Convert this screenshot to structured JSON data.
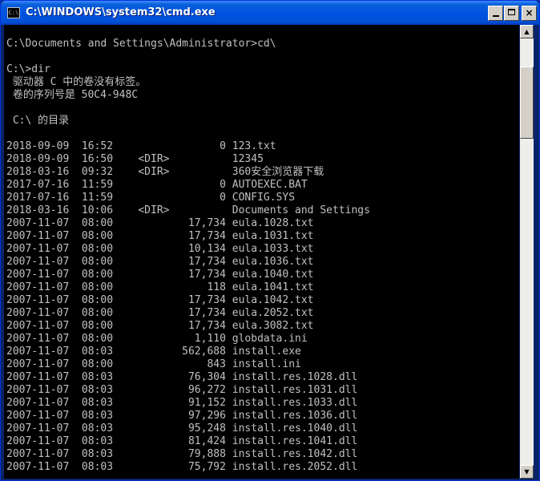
{
  "window": {
    "title": "C:\\WINDOWS\\system32\\cmd.exe",
    "icon_text": "C:\\",
    "minimize_label": "",
    "maximize_label": "",
    "close_label": "×"
  },
  "scrollbar": {
    "up_arrow": "▲",
    "down_arrow": "▼"
  },
  "console": {
    "lines": [
      "",
      "C:\\Documents and Settings\\Administrator>cd\\",
      "",
      "C:\\>dir",
      " 驱动器 C 中的卷没有标签。",
      " 卷的序列号是 50C4-948C",
      "",
      " C:\\ 的目录",
      "",
      "2018-09-09  16:52                 0 123.txt",
      "2018-09-09  16:50    <DIR>          12345",
      "2018-03-16  09:32    <DIR>          360安全浏览器下载",
      "2017-07-16  11:59                 0 AUTOEXEC.BAT",
      "2017-07-16  11:59                 0 CONFIG.SYS",
      "2018-03-16  10:06    <DIR>          Documents and Settings",
      "2007-11-07  08:00            17,734 eula.1028.txt",
      "2007-11-07  08:00            17,734 eula.1031.txt",
      "2007-11-07  08:00            10,134 eula.1033.txt",
      "2007-11-07  08:00            17,734 eula.1036.txt",
      "2007-11-07  08:00            17,734 eula.1040.txt",
      "2007-11-07  08:00               118 eula.1041.txt",
      "2007-11-07  08:00            17,734 eula.1042.txt",
      "2007-11-07  08:00            17,734 eula.2052.txt",
      "2007-11-07  08:00            17,734 eula.3082.txt",
      "2007-11-07  08:00             1,110 globdata.ini",
      "2007-11-07  08:03           562,688 install.exe",
      "2007-11-07  08:00               843 install.ini",
      "2007-11-07  08:03            76,304 install.res.1028.dll",
      "2007-11-07  08:03            96,272 install.res.1031.dll",
      "2007-11-07  08:03            91,152 install.res.1033.dll",
      "2007-11-07  08:03            97,296 install.res.1036.dll",
      "2007-11-07  08:03            95,248 install.res.1040.dll",
      "2007-11-07  08:03            81,424 install.res.1041.dll",
      "2007-11-07  08:03            79,888 install.res.1042.dll",
      "2007-11-07  08:03            75,792 install.res.2052.dll"
    ]
  }
}
